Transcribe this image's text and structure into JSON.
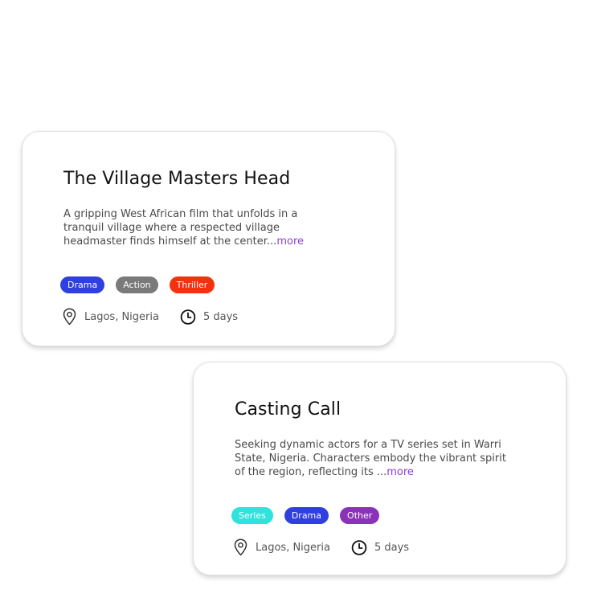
{
  "cards": [
    {
      "title": "The Village Masters Head",
      "description": "A gripping West African film that unfolds in a tranquil village where a respected village headmaster finds himself at the center...",
      "more": "more",
      "tags": [
        {
          "label": "Drama",
          "color": "#2f3fe0"
        },
        {
          "label": "Action",
          "color": "#7a7a7a"
        },
        {
          "label": "Thriller",
          "color": "#f2320e"
        }
      ],
      "location": "Lagos, Nigeria",
      "duration": "5 days",
      "location_icon": "map-pin-icon",
      "duration_icon": "clock-icon"
    },
    {
      "title": "Casting Call",
      "description": "Seeking dynamic actors for a TV series set in Warri State, Nigeria. Characters embody the vibrant spirit of the region, reflecting its ...",
      "more": "more",
      "tags": [
        {
          "label": "Series",
          "color": "#2fe3dc"
        },
        {
          "label": "Drama",
          "color": "#2f3fe0"
        },
        {
          "label": "Other",
          "color": "#8a33b8"
        }
      ],
      "location": "Lagos, Nigeria",
      "duration": "5 days",
      "location_icon": "map-pin-icon",
      "duration_icon": "clock-icon"
    }
  ],
  "colors": {
    "more_link": "#8a3fd9",
    "title_text": "#111111",
    "body_text": "#4a4a4a",
    "meta_text": "#555555"
  }
}
